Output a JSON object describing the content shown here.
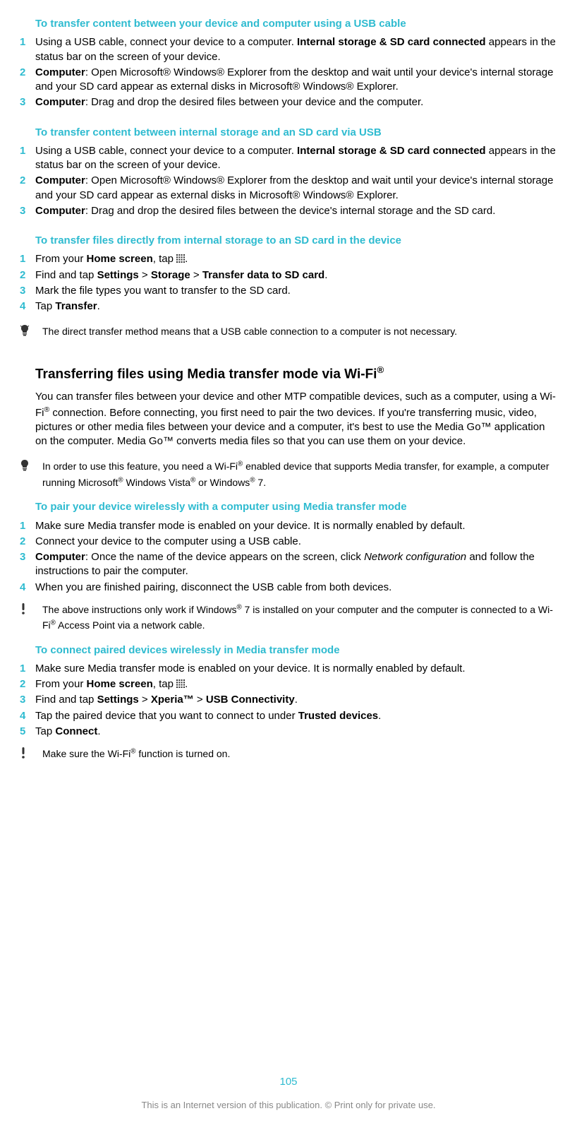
{
  "section1": {
    "title": "To transfer content between your device and computer using a USB cable",
    "steps": [
      {
        "n": "1",
        "pre": "Using a USB cable, connect your device to a computer. ",
        "bold": "Internal storage & SD card connected",
        "post": " appears in the status bar on the screen of your device."
      },
      {
        "n": "2",
        "pre": "",
        "bold": "Computer",
        "post": ": Open Microsoft® Windows® Explorer from the desktop and wait until your device's internal storage and your SD card appear as external disks in Microsoft® Windows® Explorer."
      },
      {
        "n": "3",
        "pre": "",
        "bold": "Computer",
        "post": ": Drag and drop the desired files between your device and the computer."
      }
    ]
  },
  "section2": {
    "title": "To transfer content between internal storage and an SD card via USB",
    "steps": [
      {
        "n": "1",
        "pre": "Using a USB cable, connect your device to a computer. ",
        "bold": "Internal storage & SD card connected",
        "post": " appears in the status bar on the screen of your device."
      },
      {
        "n": "2",
        "pre": "",
        "bold": "Computer",
        "post": ": Open Microsoft® Windows® Explorer from the desktop and wait until your device's internal storage and your SD card appear as external disks in Microsoft® Windows® Explorer."
      },
      {
        "n": "3",
        "pre": "",
        "bold": "Computer",
        "post": ": Drag and drop the desired files between the device's internal storage and the SD card."
      }
    ]
  },
  "section3": {
    "title": "To transfer files directly from internal storage to an SD card in the device",
    "step1": {
      "n": "1",
      "pre": "From your ",
      "bold": "Home screen",
      "post": ", tap "
    },
    "step2": {
      "n": "2",
      "a": "Find and tap ",
      "b": "Settings",
      "c": " > ",
      "d": "Storage",
      "e": " > ",
      "f": "Transfer data to SD card",
      "g": "."
    },
    "step3": {
      "n": "3",
      "text": "Mark the file types you want to transfer to the SD card."
    },
    "step4": {
      "n": "4",
      "a": "Tap ",
      "b": "Transfer",
      "c": "."
    },
    "tip": "The direct transfer method means that a USB cable connection to a computer is not necessary."
  },
  "bigsection": {
    "title_a": "Transferring files using Media transfer mode via Wi-Fi",
    "title_sup": "®",
    "para_a": "You can transfer files between your device and other MTP compatible devices, such as a computer, using a Wi-Fi",
    "para_b": " connection. Before connecting, you first need to pair the two devices. If you're transferring music, video, pictures or other media files between your device and a computer, it's best to use the Media Go™ application on the computer. Media Go™ converts media files so that you can use them on your device.",
    "tip_a": "In order to use this feature, you need a Wi-Fi",
    "tip_b": " enabled device that supports Media transfer, for example, a computer running Microsoft",
    "tip_c": " Windows Vista",
    "tip_d": " or Windows",
    "tip_e": " 7."
  },
  "section5": {
    "title": "To pair your device wirelessly with a computer using Media transfer mode",
    "step1": {
      "n": "1",
      "text": "Make sure Media transfer mode is enabled on your device. It is normally enabled by default."
    },
    "step2": {
      "n": "2",
      "text": "Connect your device to the computer using a USB cable."
    },
    "step3": {
      "n": "3",
      "a": "",
      "b": "Computer",
      "c": ": Once the name of the device appears on the screen, click ",
      "d": "Network configuration",
      "e": " and follow the instructions to pair the computer."
    },
    "step4": {
      "n": "4",
      "text": "When you are finished pairing, disconnect the USB cable from both devices."
    },
    "tip_a": "The above instructions only work if Windows",
    "tip_b": " 7 is installed on your computer and the computer is connected to a Wi-Fi",
    "tip_c": " Access Point via a network cable."
  },
  "section6": {
    "title": "To connect paired devices wirelessly in Media transfer mode",
    "step1": {
      "n": "1",
      "text": "Make sure Media transfer mode is enabled on your device. It is normally enabled by default."
    },
    "step2": {
      "n": "2",
      "pre": "From your ",
      "bold": "Home screen",
      "post": ", tap "
    },
    "step3": {
      "n": "3",
      "a": "Find and tap ",
      "b": "Settings",
      "c": " > ",
      "d": "Xperia™",
      "e": " > ",
      "f": "USB Connectivity",
      "g": "."
    },
    "step4": {
      "n": "4",
      "a": "Tap the paired device that you want to connect to under ",
      "b": "Trusted devices",
      "c": "."
    },
    "step5": {
      "n": "5",
      "a": "Tap ",
      "b": "Connect",
      "c": "."
    },
    "tip_a": "Make sure the Wi-Fi",
    "tip_b": " function is turned on."
  },
  "page_number": "105",
  "footer": "This is an Internet version of this publication. © Print only for private use."
}
